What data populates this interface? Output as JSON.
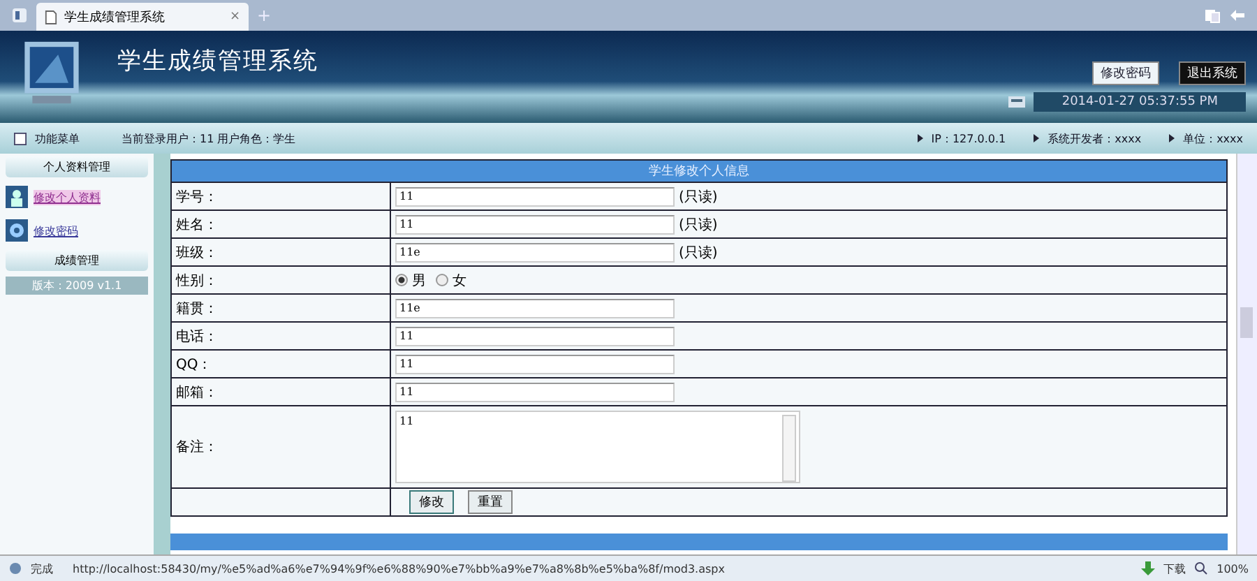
{
  "browser": {
    "tab_title": "学生成绩管理系统",
    "new_tab": "+",
    "close": "×"
  },
  "header": {
    "title": "学生成绩管理系统",
    "buttons": [
      "修改密码",
      "退出系统"
    ],
    "datetime": "2014-01-27 05:37:55 PM"
  },
  "info_bar": {
    "menu_label": "功能菜单",
    "user": "当前登录用户：11  用户角色：学生",
    "items": [
      "IP：127.0.0.1",
      "系统开发者：xxxx",
      "单位：xxxx"
    ]
  },
  "sidebar": {
    "sections": [
      {
        "title": "个人资料管理",
        "items": [
          {
            "label": "修改个人资料",
            "selected": true
          },
          {
            "label": "修改密码",
            "selected": false
          }
        ]
      },
      {
        "title": "成绩管理"
      }
    ],
    "version": "版本：2009 v1.1"
  },
  "form": {
    "title": "学生修改个人信息",
    "rows": [
      {
        "kind": "text",
        "label": "学号：",
        "value": "11",
        "note": "(只读)"
      },
      {
        "kind": "text",
        "label": "姓名：",
        "value": "11",
        "note": "(只读)"
      },
      {
        "kind": "text",
        "label": "班级：",
        "value": "11e",
        "note": "(只读)"
      },
      {
        "kind": "radio",
        "label": "性别：",
        "options": [
          {
            "label": "男",
            "selected": true
          },
          {
            "label": "女",
            "selected": false
          }
        ]
      },
      {
        "kind": "text",
        "label": "籍贯：",
        "value": "11e"
      },
      {
        "kind": "text",
        "label": "电话：",
        "value": "11"
      },
      {
        "kind": "text",
        "label": "QQ：",
        "value": "11"
      },
      {
        "kind": "text",
        "label": "邮箱：",
        "value": "11"
      },
      {
        "kind": "textarea",
        "label": "备注：",
        "value": "11"
      }
    ],
    "buttons": [
      "修改",
      "重置"
    ]
  },
  "status_bar": {
    "status": "完成",
    "url": "http://localhost:58430/my/%e5%ad%a6%e7%94%9f%e6%88%90%e7%bb%a9%e7%a8%8b%e5%ba%8f/mod3.aspx",
    "download": "下载",
    "zoom": "100%"
  }
}
